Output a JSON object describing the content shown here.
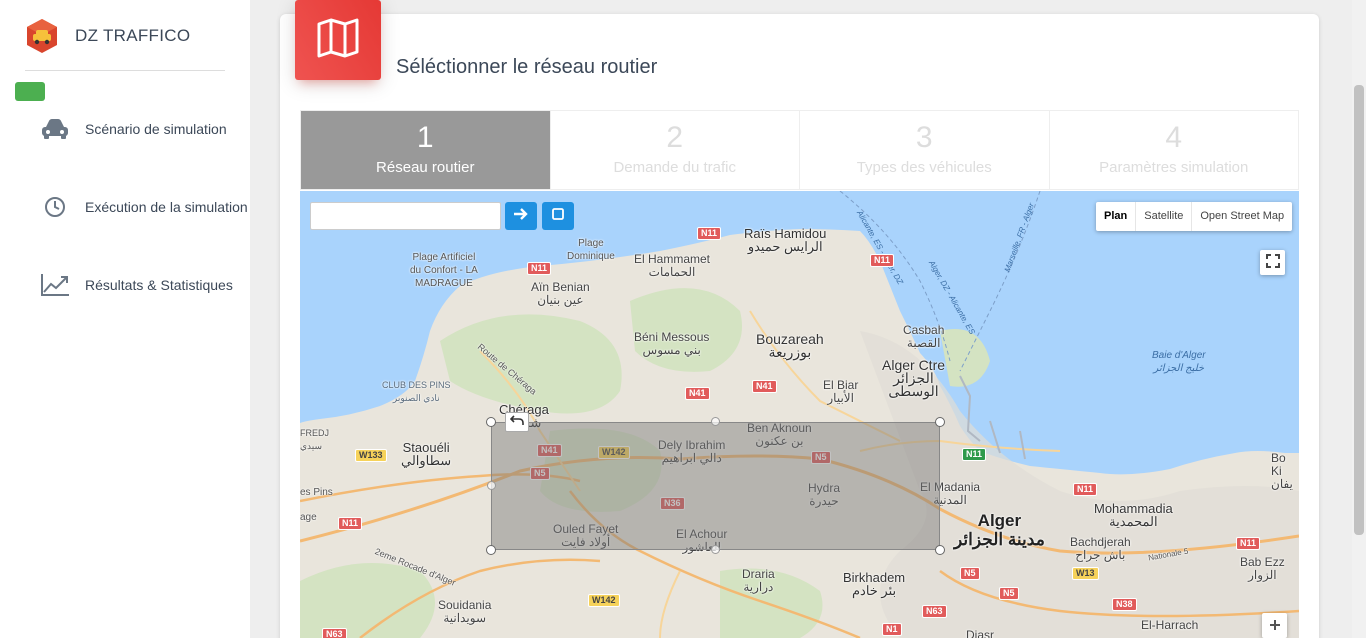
{
  "app": {
    "name": "DZ TRAFFICO",
    "status_color": "#4caf50"
  },
  "sidebar": {
    "items": [
      {
        "label": "Scénario de simulation",
        "icon": "car-icon"
      },
      {
        "label": "Exécution de la simulation",
        "icon": "clock-icon"
      },
      {
        "label": "Résultats & Statistiques",
        "icon": "chart-line-icon"
      }
    ]
  },
  "card": {
    "title": "Séléctionner le réseau routier",
    "icon": "map-icon",
    "accent": "#e53935"
  },
  "steps": [
    {
      "num": "1",
      "label": "Réseau routier",
      "active": true
    },
    {
      "num": "2",
      "label": "Demande du trafic",
      "active": false
    },
    {
      "num": "3",
      "label": "Types des véhicules",
      "active": false
    },
    {
      "num": "4",
      "label": "Paramètres simulation",
      "active": false
    }
  ],
  "map": {
    "search": {
      "value": "",
      "placeholder": ""
    },
    "types": [
      "Plan",
      "Satellite",
      "Open Street Map"
    ],
    "selected_type": "Plan",
    "places": {
      "rais_hamidou": "Raïs Hamidou",
      "rais_hamidou_ar": "الرايس حميدو",
      "el_hammamet": "El Hammamet",
      "el_hammamet_ar": "الحمامات",
      "plage_dominique_1": "Plage",
      "plage_dominique_2": "Dominique",
      "plage_artificiel_1": "Plage Artificiel",
      "plage_artificiel_2": "du Confort - LA",
      "plage_artificiel_3": "MADRAGUE",
      "ain_benian": "Aïn Benian",
      "ain_benian_ar": "عين بنيان",
      "beni_messous": "Béni Messous",
      "beni_messous_ar": "بني مسوس",
      "bouzareah": "Bouzareah",
      "bouzareah_ar": "بوزريعة",
      "casbah": "Casbah",
      "casbah_ar": "القصبة",
      "alger_ctre": "Alger Ctre",
      "alger_ctre_ar1": "الجزائر",
      "alger_ctre_ar2": "الوسطى",
      "el_biar": "El Biar",
      "el_biar_ar": "الأبيار",
      "baie_alger": "Baie d'Alger",
      "baie_alger_ar": "خليج الجزائر",
      "club_des_pins": "CLUB DES PINS",
      "club_des_pins_ar": "نادي الصنوبر",
      "cheraga": "Chéraga",
      "cheraga_ar": "شراقة",
      "staoueli": "Staouéli",
      "staoueli_ar": "سطاوالي",
      "dely_ibrahim": "Dely Ibrahim",
      "dely_ibrahim_ar": "دالي ابراهيم",
      "ben_aknoun": "Ben Aknoun",
      "ben_aknoun_ar": "بن عكنون",
      "hydra": "Hydra",
      "hydra_ar": "حيدرة",
      "el_madania": "El Madania",
      "el_madania_ar": "المدنية",
      "alger": "Alger",
      "alger_ar": "مدينة الجزائر",
      "ouled_fayet": "Ouled Fayet",
      "ouled_fayet_ar": "أولاد فايت",
      "el_achour": "El Achour",
      "el_achour_ar": "العاشور",
      "draria": "Draria",
      "draria_ar": "درارية",
      "birkhadem": "Birkhadem",
      "birkhadem_ar": "بئر خادم",
      "mohammadia": "Mohammadia",
      "mohammadia_ar": "المحمدية",
      "bachdjerah": "Bachdjerah",
      "bachdjerah_ar": "باش جراح",
      "bab_ezz": "Bab Ezz",
      "bab_ezz_ar": "الزوار",
      "bo": "Bo",
      "ki": "Ki",
      "ki_ar": "يفان",
      "souidania": "Souidania",
      "souidania_ar": "سويدانية",
      "el_harrach": "El-Harrach",
      "diasr": "Diasr",
      "es_pins": "es Pins",
      "fredj": "FREDJ",
      "fredj_ar": "سيدي",
      "age": "age",
      "route_cheraga": "Route de Chéraga",
      "rocade": "2eme Rocade d'Alger",
      "nationale5": "Nationale 5",
      "ferry1": "Alicante, ES - Alger, DZ",
      "ferry2": "Alger, DZ - Alicante, ES",
      "ferry3": "Marseille, FR - Alger"
    },
    "shields": {
      "n11a": "N11",
      "n11b": "N11",
      "n11c": "N11",
      "n11d": "N11",
      "n11e": "N11",
      "n41a": "N41",
      "n41b": "N41",
      "n41c": "N41",
      "w142a": "W142",
      "w142b": "W142",
      "w142c": "W142",
      "w133": "W133",
      "n5a": "N5",
      "n5b": "N5",
      "n5c": "N5",
      "n5d": "N5",
      "n36": "N36",
      "n38": "N38",
      "n63a": "N63",
      "n63b": "N63",
      "n1": "N1",
      "w13": "W13",
      "n11f": "N11",
      "n11g": "N11"
    }
  }
}
